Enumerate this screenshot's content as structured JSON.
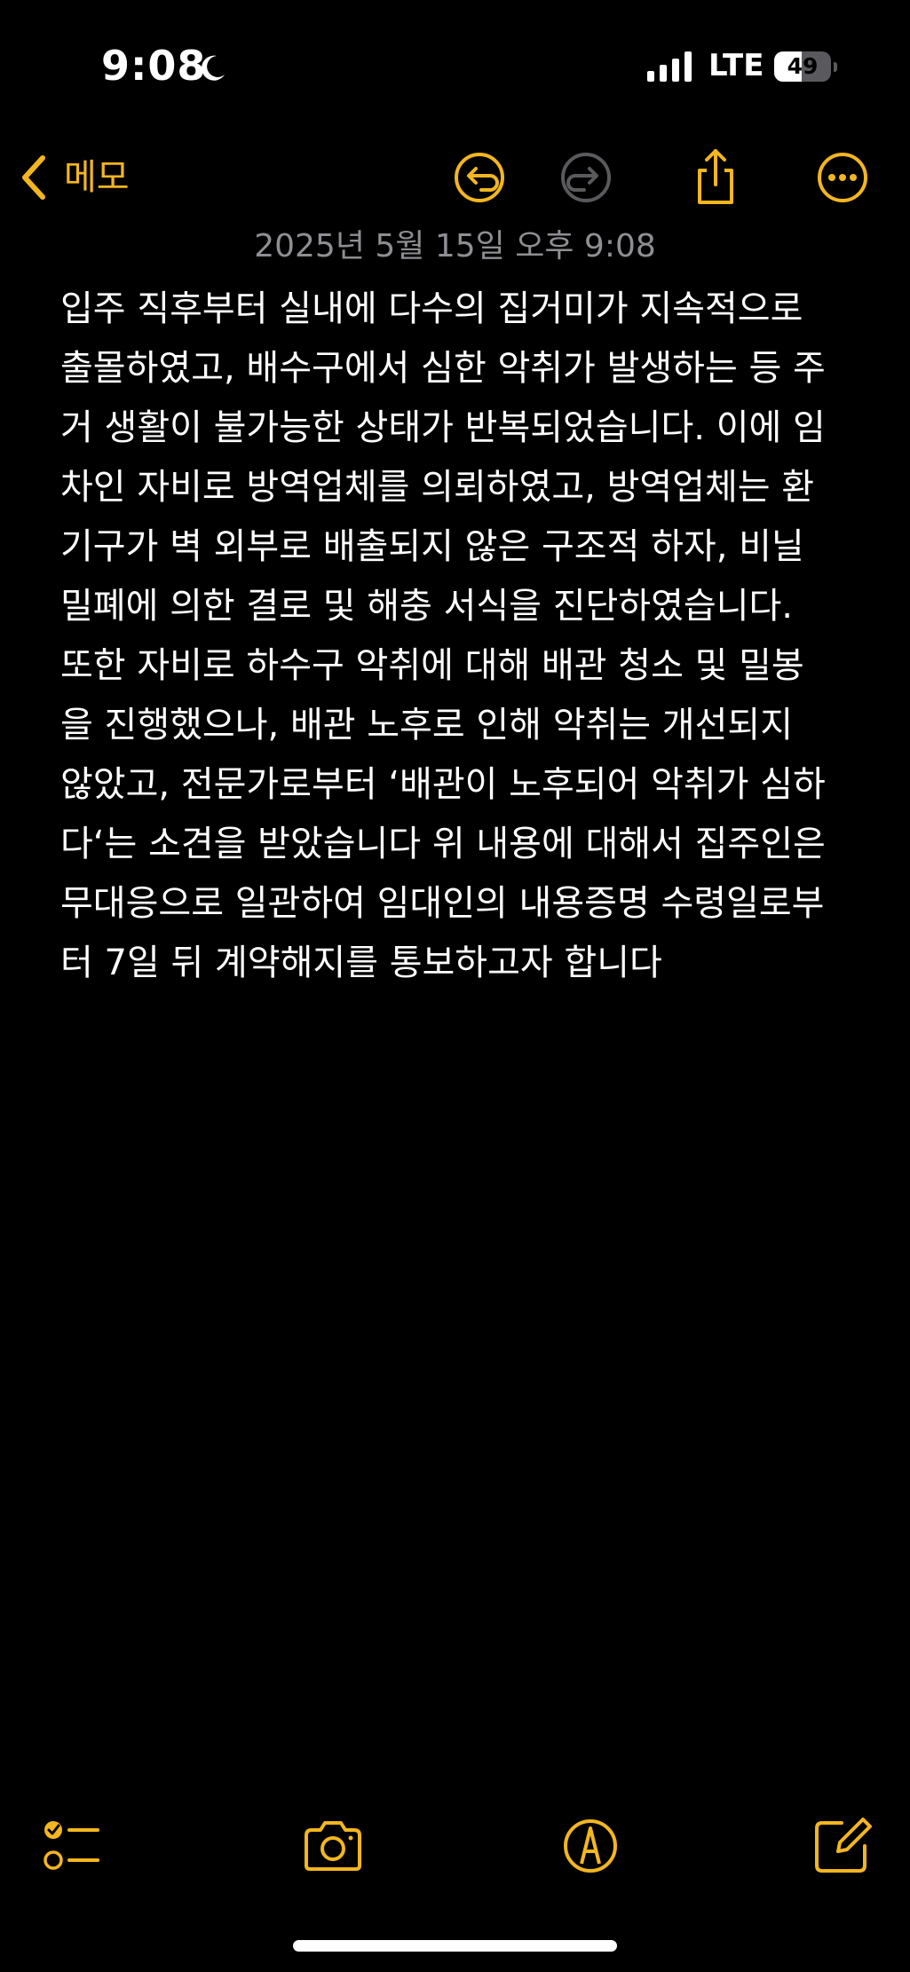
{
  "status_bar": {
    "time": "9:08",
    "network": "LTE",
    "battery_percent": "49",
    "battery_level": 0.49,
    "focus_icon": "moon-icon",
    "signal_icon": "cellular-signal-icon"
  },
  "nav": {
    "back_label": "메모",
    "icons": [
      "undo-icon",
      "redo-icon",
      "share-icon",
      "more-icon"
    ]
  },
  "note": {
    "date": "2025년 5월 15일 오후 9:08",
    "lines": [
      "입주 직후부터 실내에 다수의 집거미가 지속적으로",
      "출몰하였고, 배수구에서 심한 악취가 발생하는 등 주",
      "거 생활이 불가능한 상태가 반복되었습니다. 이에 임",
      "차인 자비로 방역업체를 의뢰하였고, 방역업체는 환",
      "기구가 벽 외부로 배출되지 않은 구조적 하자, 비닐",
      "밀폐에 의한 결로 및 해충 서식을 진단하였습니다.",
      "또한 자비로 하수구 악취에 대해 배관 청소 및 밀봉",
      "을 진행했으나, 배관 노후로 인해 악취는 개선되지",
      "않았고, 전문가로부터 ‘배관이 노후되어 악취가 심하",
      "다‘는 소견을 받았습니다 위 내용에 대해서 집주인은",
      "무대응으로 일관하여 임대인의 내용증명 수령일로부",
      "터 7일 뒤 계약해지를 통보하고자 합니다"
    ]
  },
  "toolbar": {
    "icons": [
      "checklist-icon",
      "camera-icon",
      "markup-icon",
      "compose-icon"
    ]
  },
  "colors": {
    "accent": "#f3b61f",
    "disabled": "#5a5a5e",
    "background": "#000000",
    "date_text": "#8e8e93",
    "body_text": "#ffffff"
  }
}
